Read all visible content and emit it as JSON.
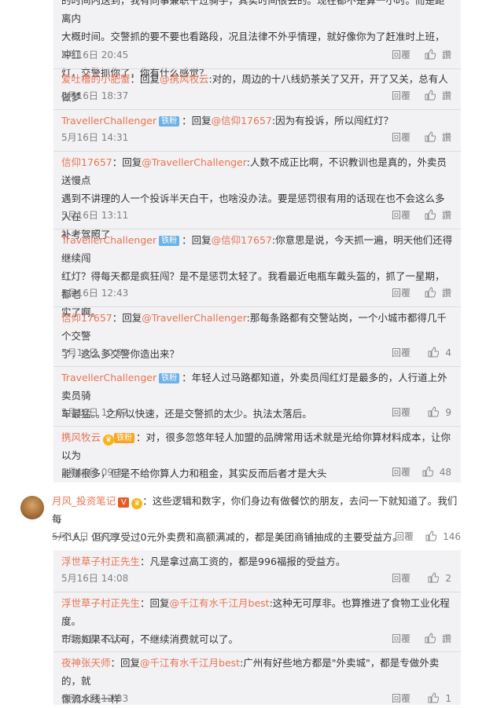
{
  "replies": [
    {
      "lines": [
        "的时间内送到，我有同事兼职干过骑手，其实时间很丢的。现在都不是算一小时。而是距离内",
        "大概时间。交警抓的要不要也看路段，况且法律不外乎情理，就好像你为了赶准时上班，冲红",
        "灯，交警抓你了，你有什么感觉？"
      ],
      "time": "5月16日 20:45",
      "reply": "回覆",
      "like": "讚"
    },
    {
      "user": "爱吐槽的小肥蟹",
      "sep": "：回复",
      "mention": "@携风牧云",
      "text": ":对的，周边的十八线奶茶关了又开，开了又关，总有人做梦",
      "time": "5月16日 18:37",
      "reply": "回覆",
      "like": "讚"
    },
    {
      "user": "TravellerChallenger",
      "badge": "铁粉",
      "sep": "：回复",
      "mention": "@信仰17657",
      "text": ":因为有投诉，所以闯红灯？",
      "time": "5月16日 14:31",
      "reply": "回覆",
      "like": "讚"
    },
    {
      "user": "信仰17657",
      "sep": "：回复",
      "mention": "@TravellerChallenger",
      "text": ":人数不成正比啊，不识教训也是真的，外卖员送慢点",
      "lines": [
        "遇到不讲理的人一个投诉半天白干，也啥没办法。要是惩罚很有用的话现在也不会这么多人在",
        "补考驾照了"
      ],
      "time": "5月16日 13:11",
      "reply": "回覆",
      "like": "讚"
    },
    {
      "user": "TravellerChallenger",
      "badge": "铁粉",
      "sep": "：回复",
      "mention": "@信仰17657",
      "text": ":你意思是说，今天抓一遍，明天他们还得继续闯",
      "lines": [
        "红灯？得每天都是疯狂闯？是不是惩罚太轻了。我看最近电瓶车戴头盔的，抓了一星期，都老",
        "实了啊。"
      ],
      "time": "5月16日 12:43",
      "reply": "回覆",
      "like": "讚"
    },
    {
      "user": "信仰17657",
      "sep": "：回复",
      "mention": "@TravellerChallenger",
      "text": ":那每条路都有交警站岗，一个小城市都得几千个交警",
      "lines": [
        "了，这么多交警你造出来？"
      ],
      "time": "5月16日 10:59",
      "reply": "回覆",
      "like": "4"
    },
    {
      "user": "TravellerChallenger",
      "badge": "铁粉",
      "sep": "：",
      "text": "年轻人过马路都知道，外卖员闯红灯是最多的，人行道上外卖员骑",
      "lines": [
        "车最猛。。之所以快速，还是交警抓的太少。执法太落后。"
      ],
      "time": "5月16日 10:07",
      "reply": "回覆",
      "like": "9"
    },
    {
      "user": "携风牧云",
      "badge2": "铁粉",
      "sep": "：",
      "text": "对，很多忽悠年轻人加盟的品牌常用话术就是光给你算材料成本，让你以为",
      "lines": [
        "能赚很多，但是不给你算人力和租金，其实反而后者才是大头"
      ],
      "time": "5月16日 09:32",
      "reply": "回覆",
      "like": "48"
    }
  ],
  "main": {
    "user": "月风_投资笔记",
    "sep": "：",
    "text": "这些逻辑和数字，你们身边有做餐饮的朋友，去问一下就知道了。我们每",
    "line2": "一个人，但凡享受过0元外卖费和高额满减的，都是美团商铺抽成的主要受益方。",
    "time": "5月16日 09:33",
    "reply": "回覆",
    "like": "146"
  },
  "subreplies": [
    {
      "user": "浮世草子村正先生",
      "sep": "：",
      "text": "凡是拿过高工资的，都是996福报的受益方。",
      "time": "5月16日 14:08",
      "reply": "回覆",
      "like": "2"
    },
    {
      "user": "浮世草子村正先生",
      "sep": "：回复",
      "mention": "@千江有水千江月best",
      "text": ":这种无可厚非。也算推进了食物工业化程度。",
      "line2": "市场如果不认可，不继续消费就可以了。",
      "time": "5月16日 12:56",
      "reply": "回覆",
      "like": "讚"
    },
    {
      "user": "夜神张天师",
      "sep": "：回复",
      "mention": "@千江有水千江月best",
      "text": ":广州有好些地方都是\"外卖城\"，都是专做外卖的，就",
      "line2": "像流水线一样",
      "time": "5月16日 12:33",
      "reply": "回覆",
      "like": "1"
    }
  ]
}
